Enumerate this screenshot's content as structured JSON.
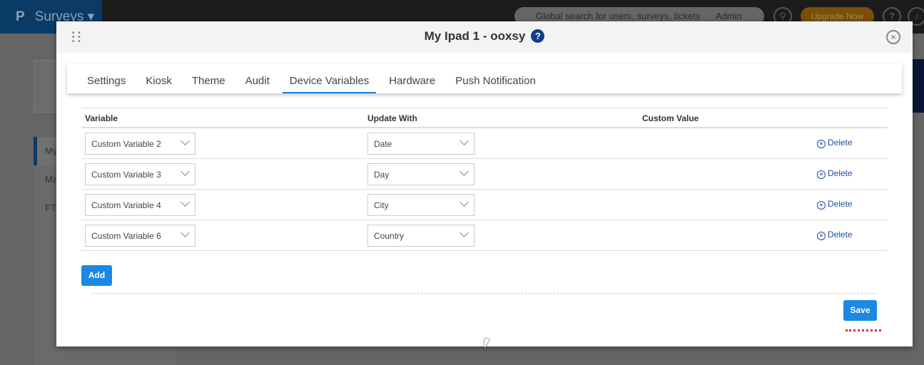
{
  "topbar": {
    "app_name": "Surveys",
    "search_placeholder": "Global search for users, surveys, tickets",
    "account": "Admin",
    "upgrade_label": "Upgrade Now"
  },
  "sidebar": {
    "items": [
      "My",
      "Ma",
      "FT"
    ]
  },
  "modal": {
    "title": "My Ipad 1 - ooxsy",
    "help": "?",
    "tabs": [
      "Settings",
      "Kiosk",
      "Theme",
      "Audit",
      "Device Variables",
      "Hardware",
      "Push Notification"
    ],
    "active_tab": "Device Variables",
    "columns": [
      "Variable",
      "Update With",
      "Custom Value"
    ],
    "rows": [
      {
        "variable": "Custom Variable 2",
        "update_with": "Date",
        "action": "Delete"
      },
      {
        "variable": "Custom Variable 3",
        "update_with": "Day",
        "action": "Delete"
      },
      {
        "variable": "Custom Variable 4",
        "update_with": "City",
        "action": "Delete"
      },
      {
        "variable": "Custom Variable 6",
        "update_with": "Country",
        "action": "Delete"
      }
    ],
    "add_label": "Add",
    "save_label": "Save"
  },
  "colors": {
    "primary": "#1b88e3",
    "link": "#1d4f9a",
    "accent_red": "#e0284a"
  }
}
